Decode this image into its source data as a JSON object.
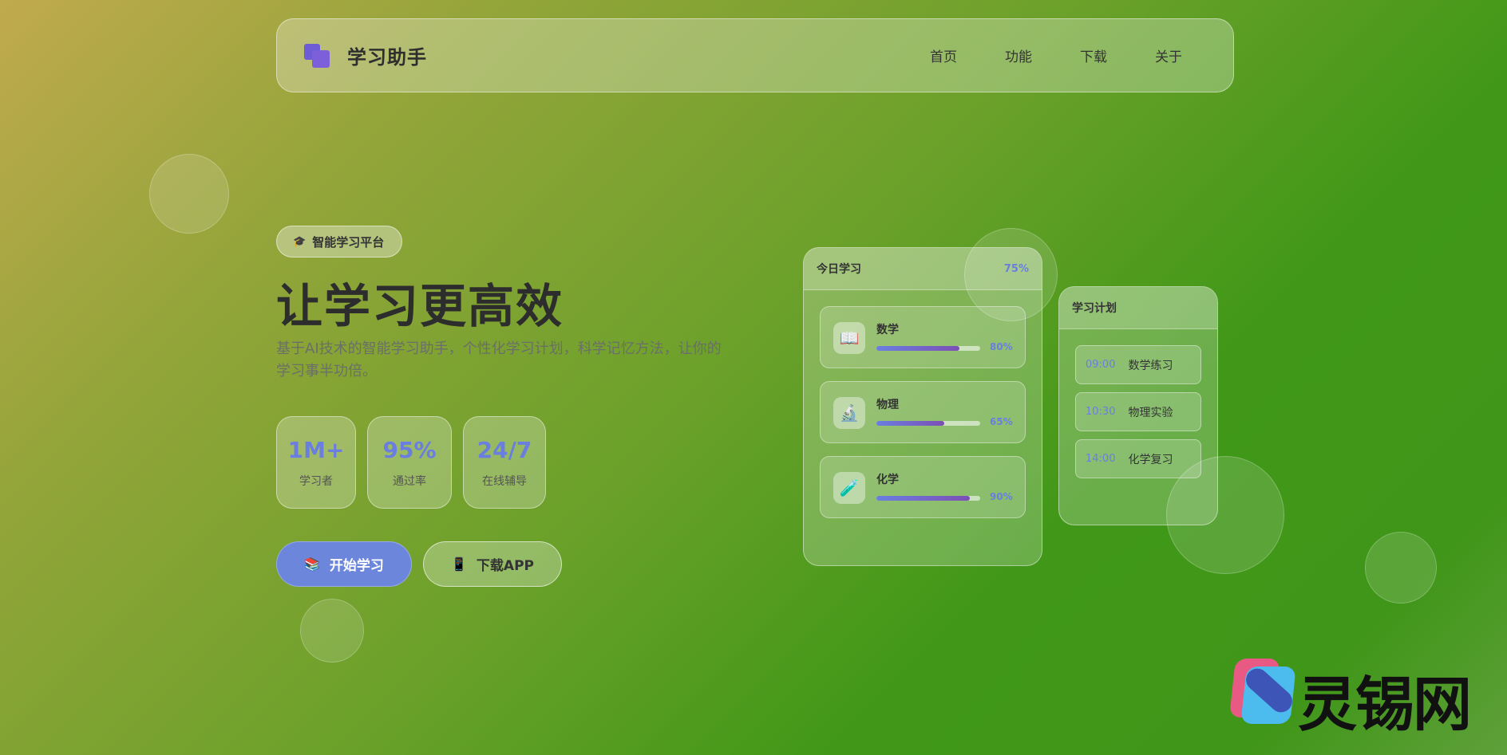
{
  "nav": {
    "brand": "学习助手",
    "links": [
      "首页",
      "功能",
      "下载",
      "关于"
    ]
  },
  "hero": {
    "badge_icon": "🎓",
    "badge_text": "智能学习平台",
    "title": "让学习更高效",
    "subtitle": "基于AI技术的智能学习助手，个性化学习计划，科学记忆方法，让你的学习事半功倍。",
    "stats": [
      {
        "value": "1M+",
        "label": "学习者"
      },
      {
        "value": "95%",
        "label": "通过率"
      },
      {
        "value": "24/7",
        "label": "在线辅导"
      }
    ],
    "primary_button": {
      "icon": "📚",
      "label": "开始学习"
    },
    "secondary_button": {
      "icon": "📱",
      "label": "下载APP"
    }
  },
  "today_card": {
    "title": "今日学习",
    "progress": "75%",
    "subjects": [
      {
        "icon": "📖",
        "name": "数学",
        "percent": "80%",
        "value": 80
      },
      {
        "icon": "🔬",
        "name": "物理",
        "percent": "65%",
        "value": 65
      },
      {
        "icon": "🧪",
        "name": "化学",
        "percent": "90%",
        "value": 90
      }
    ]
  },
  "plan_card": {
    "title": "学习计划",
    "items": [
      {
        "time": "09:00",
        "task": "数学练习"
      },
      {
        "time": "10:30",
        "task": "物理实验"
      },
      {
        "time": "14:00",
        "task": "化学复习"
      }
    ]
  },
  "watermark": {
    "text": "灵锡网"
  },
  "colors": {
    "accent": "#6a7ee0",
    "primary_button": "#6b86db",
    "logo": "#6e5bd6"
  }
}
